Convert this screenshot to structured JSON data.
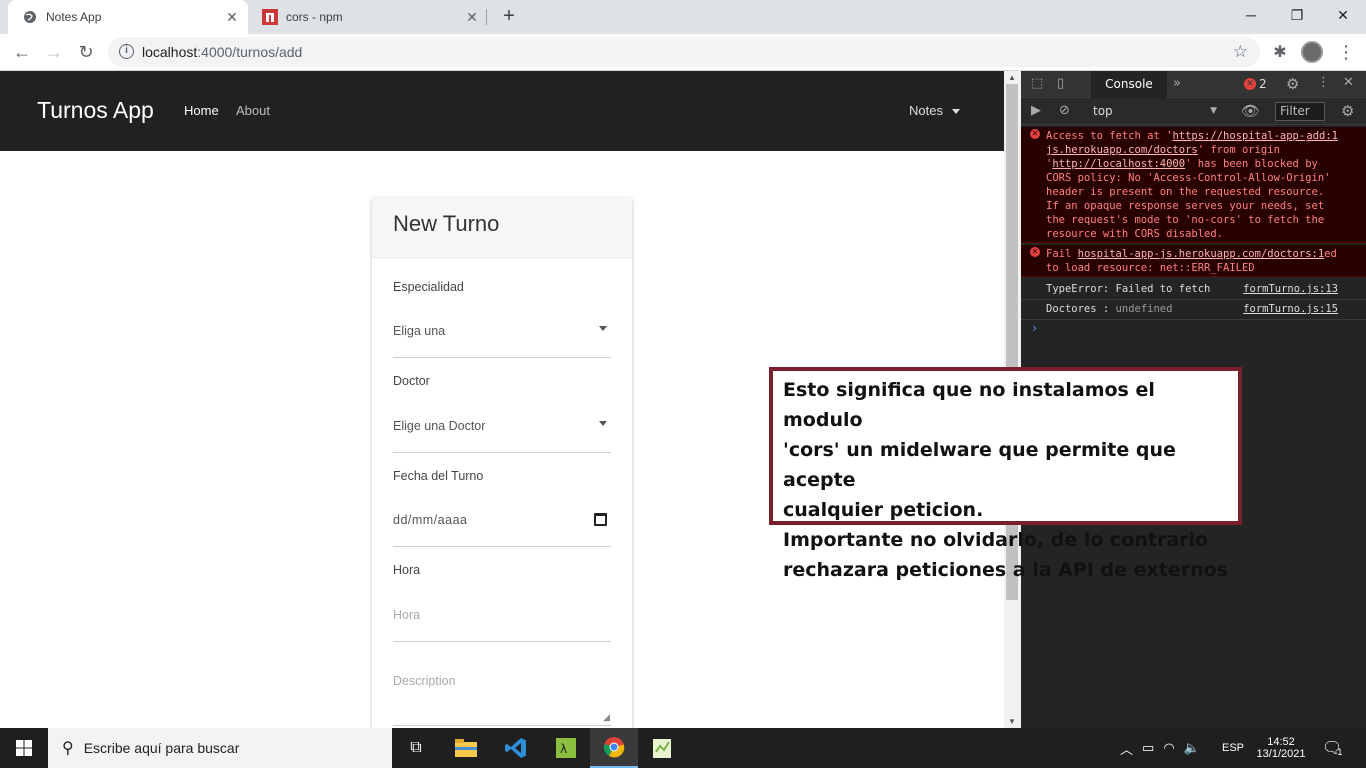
{
  "browser": {
    "tabs": [
      {
        "title": "Notes App",
        "active": true
      },
      {
        "title": "cors - npm",
        "active": false
      }
    ],
    "url_host": "localhost",
    "url_rest": ":4000/turnos/add"
  },
  "navbar": {
    "brand": "Turnos App",
    "links": [
      "Home",
      "About"
    ],
    "dropdown": "Notes"
  },
  "form": {
    "title": "New Turno",
    "especialidad_label": "Especialidad",
    "especialidad_value": "Eliga una",
    "doctor_label": "Doctor",
    "doctor_value": "Elige una Doctor",
    "fecha_label": "Fecha del Turno",
    "fecha_placeholder": "dd/mm/aaaa",
    "hora_label": "Hora",
    "hora_placeholder": "Hora",
    "description_placeholder": "Description"
  },
  "devtools": {
    "tab": "Console",
    "error_count": "2",
    "context": "top",
    "filter_placeholder": "Filter",
    "messages": {
      "err1_a": "Access to fetch at '",
      "err1_link": "https://hospital-app-js.herokuapp.com/doctors",
      "err1_src": "add:1",
      "err1_b": "' from origin '",
      "err1_origin": "http://localhost:4000",
      "err1_c": "' has been blocked by CORS policy: No 'Access-Control-Allow-Origin' header is present on the requested resource. If an opaque response serves your needs, set the request's mode to 'no-cors' to fetch the resource with CORS disabled.",
      "err2_a": "Fail",
      "err2_link": "hospital-app-js.herokuapp.com/doctors:1",
      "err2_b": "ed to load resource: net::ERR_FAILED",
      "log1_text": "TypeError: Failed to fetch",
      "log1_src": "formTurno.js:13",
      "log2_key": "Doctores :",
      "log2_val": "undefined",
      "log2_src": "formTurno.js:15"
    }
  },
  "annotation": {
    "line1": "Esto significa que no instalamos el modulo",
    "line2": "'cors' un midelware que permite que acepte",
    "line3": "cualquier peticion.",
    "line4": "Importante no olvidarlo, de lo contrario",
    "line5": "rechazara peticiones a la API de externos"
  },
  "taskbar": {
    "search_placeholder": "Escribe aquí para buscar",
    "lang": "ESP",
    "time": "14:52",
    "date": "13/1/2021",
    "notif_count": "1"
  }
}
